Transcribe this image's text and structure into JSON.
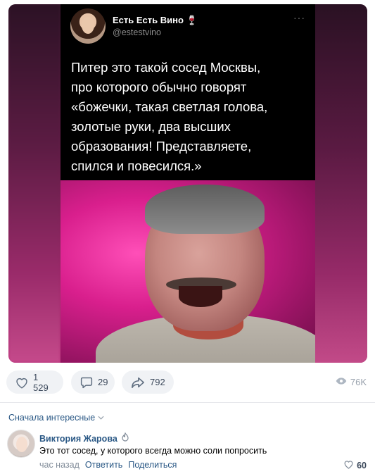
{
  "tweet": {
    "author_name": "Есть Есть Вино 🍷",
    "handle": "@estestvino",
    "more": "···",
    "text": "Питер это такой сосед Москвы,\nпро которого обычно говорят\n«божечки, такая светлая голова,\nзолотые руки, два высших\nобразования! Представляете,\nспился и повесился.»"
  },
  "actions": {
    "likes": "1 529",
    "comments": "29",
    "shares": "792",
    "views": "76K"
  },
  "comments": {
    "sort_label": "Сначала интересные",
    "items": [
      {
        "author": "Виктория Жарова",
        "text": "Это тот сосед, у которого всегда можно соли попросить",
        "time": "час назад",
        "reply_label": "Ответить",
        "share_label": "Поделиться",
        "likes": "60"
      }
    ]
  },
  "colors": {
    "link": "#2a5885",
    "pill_bg": "#f0f2f5",
    "secondary": "#99a2ad"
  }
}
